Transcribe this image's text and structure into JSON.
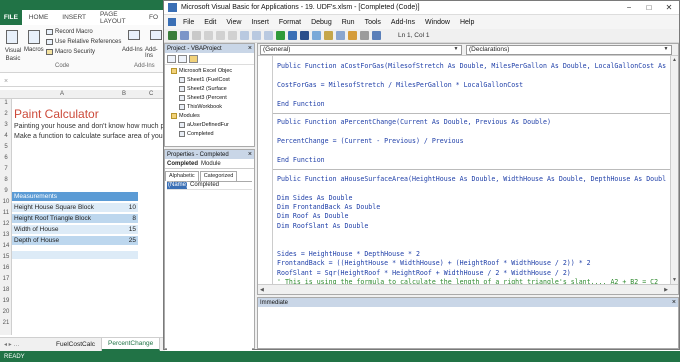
{
  "excel": {
    "tabs": [
      "FILE",
      "HOME",
      "INSERT",
      "PAGE LAYOUT",
      "FO"
    ],
    "ribbon": {
      "visual_basic": "Visual Basic",
      "macros": "Macros",
      "record_macro": "Record Macro",
      "use_relative": "Use Relative References",
      "macro_security": "Macro Security",
      "group_code": "Code",
      "addins": "Add-Ins",
      "addins2": "Add-Ins",
      "addins_group": "Add-Ins"
    },
    "formula_x": "×",
    "columns": [
      "A",
      "B",
      "C"
    ],
    "title": "Paint Calculator",
    "intro_line1": "Painting your house and don't know how much p",
    "intro_line2": "Make a function to calculate surface area of your",
    "table": {
      "header": "Measurements",
      "rows": [
        {
          "label": "Height House Square Block",
          "value": "10"
        },
        {
          "label": "Height Roof Triangle Block",
          "value": "8"
        },
        {
          "label": "Width of House",
          "value": "15"
        },
        {
          "label": "Depth of House",
          "value": "25"
        }
      ]
    },
    "row_numbers": [
      "1",
      "2",
      "3",
      "4",
      "5",
      "6",
      "7",
      "8",
      "9",
      "10",
      "11",
      "12",
      "13",
      "14",
      "15",
      "16",
      "17",
      "18",
      "19",
      "20",
      "21"
    ],
    "sheets": [
      "FuelCostCalc",
      "PercentChange"
    ],
    "sheet_nav": "◂ ▸ …",
    "status": "READY"
  },
  "vba": {
    "title": "Microsoft Visual Basic for Applications - 19. UDF's.xlsm - [Completed (Code)]",
    "menu": [
      "File",
      "Edit",
      "View",
      "Insert",
      "Format",
      "Debug",
      "Run",
      "Tools",
      "Add-Ins",
      "Window",
      "Help"
    ],
    "cursor_pos": "Ln 1, Col 1",
    "project_title": "Project - VBAProject",
    "tree": [
      {
        "label": "Microsoft Excel Objec",
        "kind": "folder"
      },
      {
        "label": "Sheet1 (FuelCost",
        "kind": "sheet"
      },
      {
        "label": "Sheet2 (Surface",
        "kind": "sheet"
      },
      {
        "label": "Sheet3 (Percent",
        "kind": "sheet"
      },
      {
        "label": "ThisWorkbook",
        "kind": "sheet"
      },
      {
        "label": "Modules",
        "kind": "folder"
      },
      {
        "label": "aUserDefinedFur",
        "kind": "module"
      },
      {
        "label": "Completed",
        "kind": "module"
      }
    ],
    "properties_title": "Properties - Completed",
    "properties_object": "Completed",
    "properties_type": "Module",
    "properties_tabs": [
      "Alphabetic",
      "Categorized"
    ],
    "property_name_key": "(Name)",
    "property_name_value": "Completed",
    "dropdown_general": "(General)",
    "dropdown_declarations": "(Declarations)",
    "code_lines": [
      {
        "text": "Public Function aCostForGas(MilesofStretch As Double, MilesPerGallon As Double, LocalGallonCost As",
        "type": "code"
      },
      {
        "text": "",
        "type": "code"
      },
      {
        "text": "CostForGas = MilesofStretch / MilesPerGallon * LocalGallonCost",
        "type": "code"
      },
      {
        "text": "",
        "type": "code"
      },
      {
        "text": "End Function",
        "type": "code"
      },
      {
        "text": "",
        "type": "sep"
      },
      {
        "text": "Public Function aPercentChange(Current As Double, Previous As Double)",
        "type": "code"
      },
      {
        "text": "",
        "type": "code"
      },
      {
        "text": "PercentChange = (Current - Previous) / Previous",
        "type": "code"
      },
      {
        "text": "",
        "type": "code"
      },
      {
        "text": "End Function",
        "type": "code"
      },
      {
        "text": "",
        "type": "sep"
      },
      {
        "text": "Public Function aHouseSurfaceArea(HeightHouse As Double, WidthHouse As Double, DepthHouse As Doubl",
        "type": "code"
      },
      {
        "text": "",
        "type": "code"
      },
      {
        "text": "Dim Sides As Double",
        "type": "code"
      },
      {
        "text": "Dim FrontandBack As Double",
        "type": "code"
      },
      {
        "text": "Dim Roof As Double",
        "type": "code"
      },
      {
        "text": "Dim RoofSlant As Double",
        "type": "code"
      },
      {
        "text": "",
        "type": "code"
      },
      {
        "text": "",
        "type": "code"
      },
      {
        "text": "Sides = HeightHouse * DepthHouse * 2",
        "type": "code"
      },
      {
        "text": "FrontandBack = ((HeightHouse * WidthHouse) + (HeightRoof * WidthHouse / 2)) * 2",
        "type": "code"
      },
      {
        "text": "RoofSlant = Sqr(HeightRoof * HeightRoof + WidthHouse / 2 * WidthHouse / 2)",
        "type": "code"
      },
      {
        "text": "' This is using the formula to calculate the length of a right triangle's slant.... A2 + B2 = C2",
        "type": "comment"
      }
    ],
    "immediate_title": "Immediate",
    "win_min": "−",
    "win_max": "□",
    "win_close": "✕",
    "close_glyph": "×"
  }
}
